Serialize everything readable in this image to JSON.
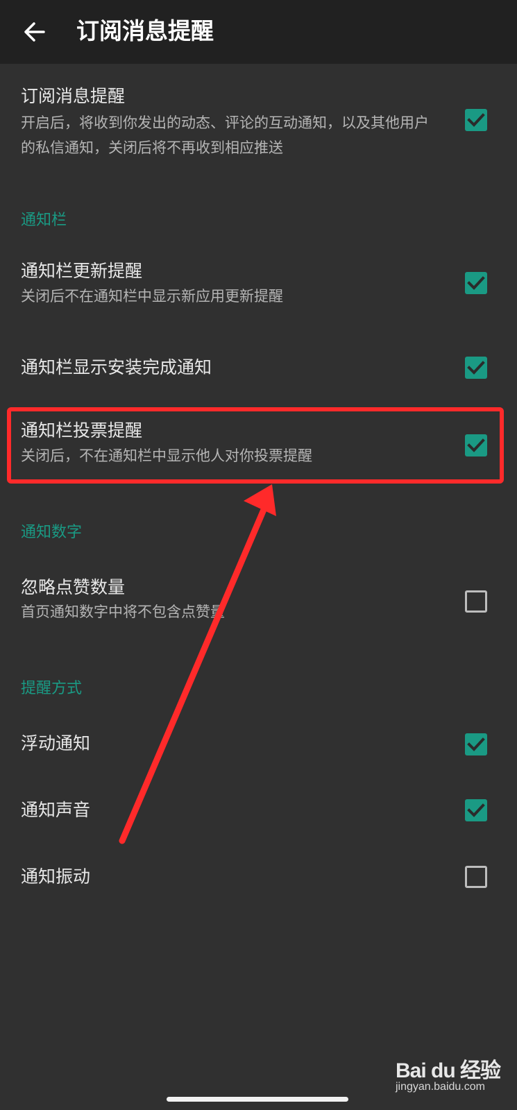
{
  "appbar": {
    "title": "订阅消息提醒",
    "back_icon": "arrow-left-icon"
  },
  "subscription": {
    "title": "订阅消息提醒",
    "description": "开启后，将收到你发出的动态、评论的互动通知，以及其他用户的私信通知，关闭后将不再收到相应推送",
    "checked": true
  },
  "sections": {
    "notification_bar": "通知栏",
    "notification_number": "通知数字",
    "reminder_method": "提醒方式"
  },
  "settings": {
    "update_reminder": {
      "title": "通知栏更新提醒",
      "description": "关闭后不在通知栏中显示新应用更新提醒",
      "checked": true
    },
    "install_complete": {
      "title": "通知栏显示安装完成通知",
      "checked": true
    },
    "vote_reminder": {
      "title": "通知栏投票提醒",
      "description": "关闭后，不在通知栏中显示他人对你投票提醒",
      "checked": true
    },
    "ignore_likes": {
      "title": "忽略点赞数量",
      "description": "首页通知数字中将不包含点赞量",
      "checked": false
    },
    "floating_notification": {
      "title": "浮动通知",
      "checked": true
    },
    "notification_sound": {
      "title": "通知声音",
      "checked": true
    },
    "notification_vibration": {
      "title": "通知振动",
      "checked": false
    }
  },
  "colors": {
    "background": "#303030",
    "appbar": "#212121",
    "accent": "#1a9a84",
    "annotation": "#ff2a2a"
  },
  "watermark": {
    "logo": "Bai du 经验",
    "sub": "jingyan.baidu.com"
  }
}
